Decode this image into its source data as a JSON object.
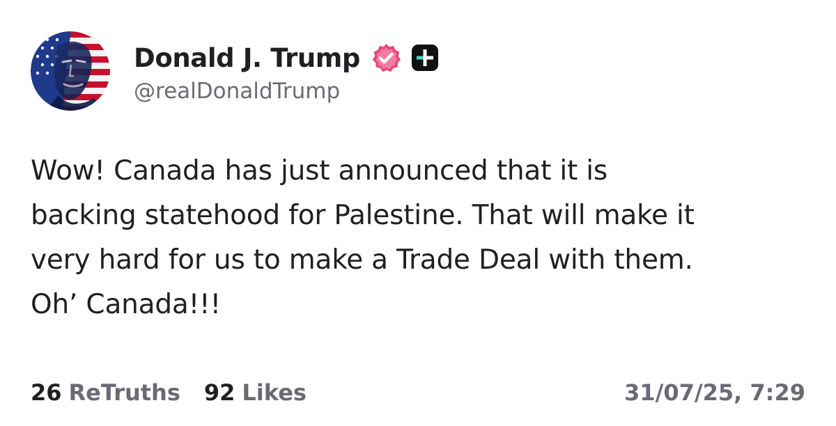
{
  "author": {
    "display_name": "Donald J. Trump",
    "handle": "@realDonaldTrump",
    "verified_badge_icon": "verified-check-icon",
    "verified_badge_color": "#e8457a",
    "plus_badge_icon": "truth-plus-icon"
  },
  "post": {
    "lines": [
      "Wow! Canada has just announced that it is",
      "backing statehood for Palestine. That will make it",
      "very hard for us to make a Trade Deal with them.",
      "Oh’ Canada!!!"
    ]
  },
  "footer": {
    "retruths_count": "26",
    "retruths_label": "ReTruths",
    "likes_count": "92",
    "likes_label": "Likes",
    "timestamp": "31/07/25, 7:29"
  },
  "colors": {
    "text_primary": "#1f1f24",
    "text_secondary": "#6a6a74",
    "background": "#ffffff"
  }
}
